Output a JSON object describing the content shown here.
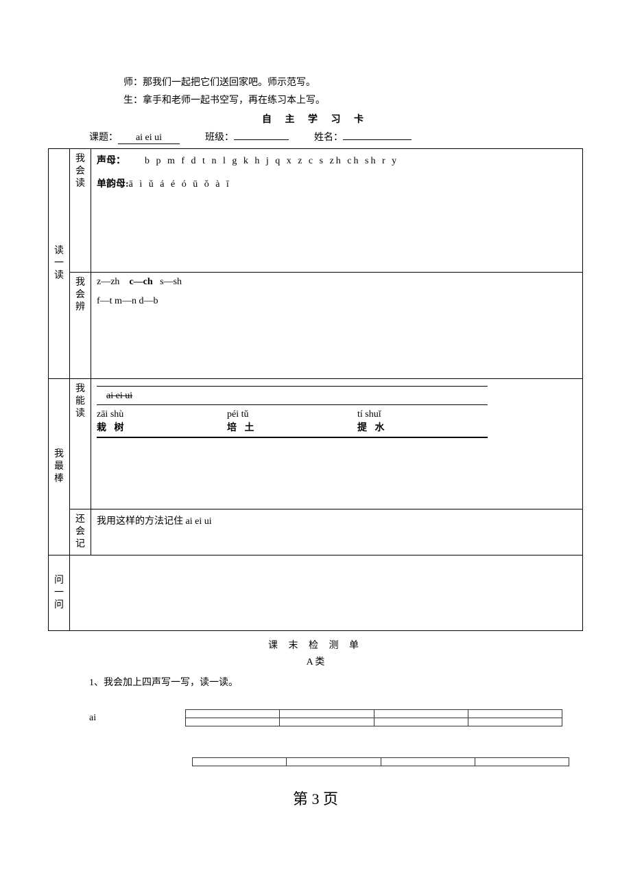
{
  "intro": {
    "line1": "师：那我们一起把它们送回家吧。师示范写。",
    "line2": "生：拿手和老师一起书空写，再在练习本上写。"
  },
  "card_title": "自 主 学 习 卡",
  "header": {
    "topic_label": "课题：",
    "topic_value": "ai  ei  ui",
    "class_label": "班级：",
    "class_value": "",
    "name_label": "姓名：",
    "name_value": ""
  },
  "table": {
    "row1": {
      "cat": "读一读",
      "sub": "我会读",
      "shengmu_label": "声母：",
      "shengmu": "b  p  m  f  d  t  n  l   g  k  h   j  q  x   z  c  s  zh ch sh   r  y",
      "danyunmu_label": "单韵母:",
      "danyunmu": "ā  ì  ǔ  á  é  ó  ū  ǒ  à  ī"
    },
    "row2": {
      "sub": "我会辨",
      "line1": "z—zh    c—ch   s—sh",
      "line2": "f—t     m—n   d—b"
    },
    "row3": {
      "cat": "我最棒",
      "sub": "我能读",
      "strike_line": "ai  ei  ui",
      "w1p": "zāi shù",
      "w1c": "栽 树",
      "w2p": "péi tǔ",
      "w2c": "培 土",
      "w3p": "tí shuǐ",
      "w3c": "提 水"
    },
    "row4": {
      "sub": "还会记",
      "text": "我用这样的方法记住 ai  ei   ui"
    },
    "row5": {
      "cat": "问一问"
    }
  },
  "test": {
    "title": "课 末 检 测 单",
    "sub": "A 类",
    "q1": "1、我会加上四声写一写，读一读。",
    "ai": "ai"
  },
  "page_num": "第 3 页"
}
